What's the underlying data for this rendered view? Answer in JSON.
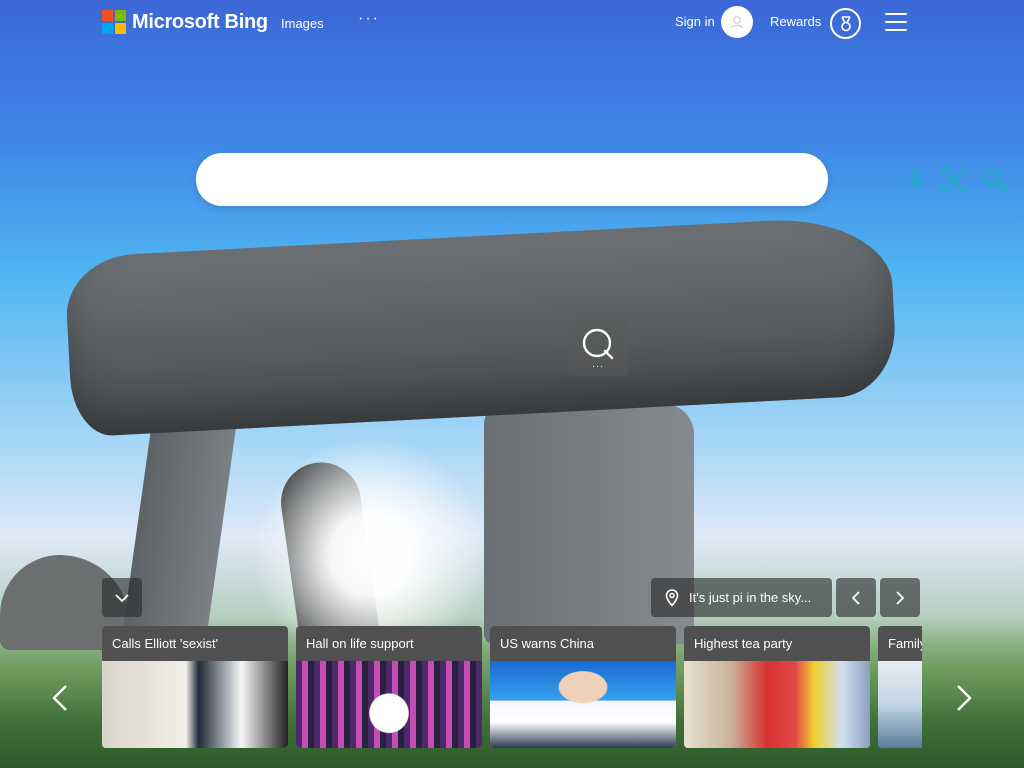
{
  "header": {
    "brand": "Microsoft Bing",
    "nav": {
      "images": "Images",
      "more": "···"
    },
    "sign_in": "Sign in",
    "rewards": "Rewards"
  },
  "search": {
    "value": "",
    "placeholder": ""
  },
  "image_info": {
    "caption": "It's just pi in the sky..."
  },
  "icons": {
    "logo": "microsoft-logo",
    "avatar": "person-icon",
    "rewards": "rewards-medal-icon",
    "menu": "hamburger-menu-icon",
    "mic": "microphone-icon",
    "visual": "visual-search-icon",
    "search": "search-icon",
    "hotspot": "search-hotspot-icon",
    "collapse": "chevron-down-icon",
    "location": "location-pin-icon"
  },
  "news": {
    "cards": [
      {
        "title": "Calls Elliott 'sexist'"
      },
      {
        "title": "Hall on life support"
      },
      {
        "title": "US warns China"
      },
      {
        "title": "Highest tea party"
      },
      {
        "title": "Family"
      }
    ]
  },
  "colors": {
    "accent": "#17b3c1",
    "ms_red": "#f25022",
    "ms_green": "#7fba00",
    "ms_blue": "#00a4ef",
    "ms_yellow": "#ffb900"
  }
}
